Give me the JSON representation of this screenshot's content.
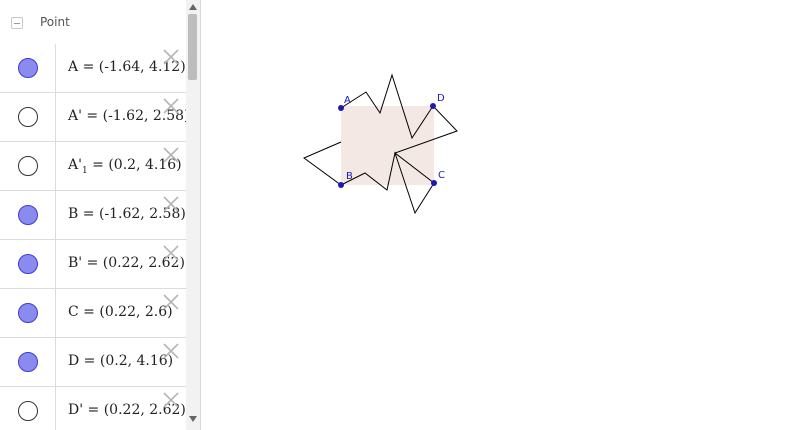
{
  "algebra": {
    "group_label": "Point",
    "rows": [
      {
        "name": "A",
        "sub": "",
        "value": "(-1.64, 4.12)",
        "visible": true
      },
      {
        "name": "A'",
        "sub": "",
        "value": "(-1.62, 2.58)",
        "visible": false
      },
      {
        "name": "A'",
        "sub": "1",
        "value": "(0.2, 4.16)",
        "visible": false
      },
      {
        "name": "B",
        "sub": "",
        "value": "(-1.62, 2.58)",
        "visible": true
      },
      {
        "name": "B'",
        "sub": "",
        "value": "(0.22, 2.62)",
        "visible": true
      },
      {
        "name": "C",
        "sub": "",
        "value": "(0.22, 2.6)",
        "visible": true
      },
      {
        "name": "D",
        "sub": "",
        "value": "(0.2, 4.16)",
        "visible": true
      },
      {
        "name": "D'",
        "sub": "",
        "value": "(0.22, 2.62)",
        "visible": false
      }
    ]
  },
  "graphics": {
    "point_labels": {
      "A": "A",
      "B": "B",
      "C": "C",
      "D": "D"
    }
  },
  "colors": {
    "marble_on": "#8b8bef",
    "point": "#1a1ab5",
    "polygon_fill": "#f3e8e3"
  },
  "icons": {
    "collapse": "minus-icon",
    "delete": "close-icon",
    "scroll_up": "triangle-up-icon",
    "scroll_down": "triangle-down-icon"
  }
}
